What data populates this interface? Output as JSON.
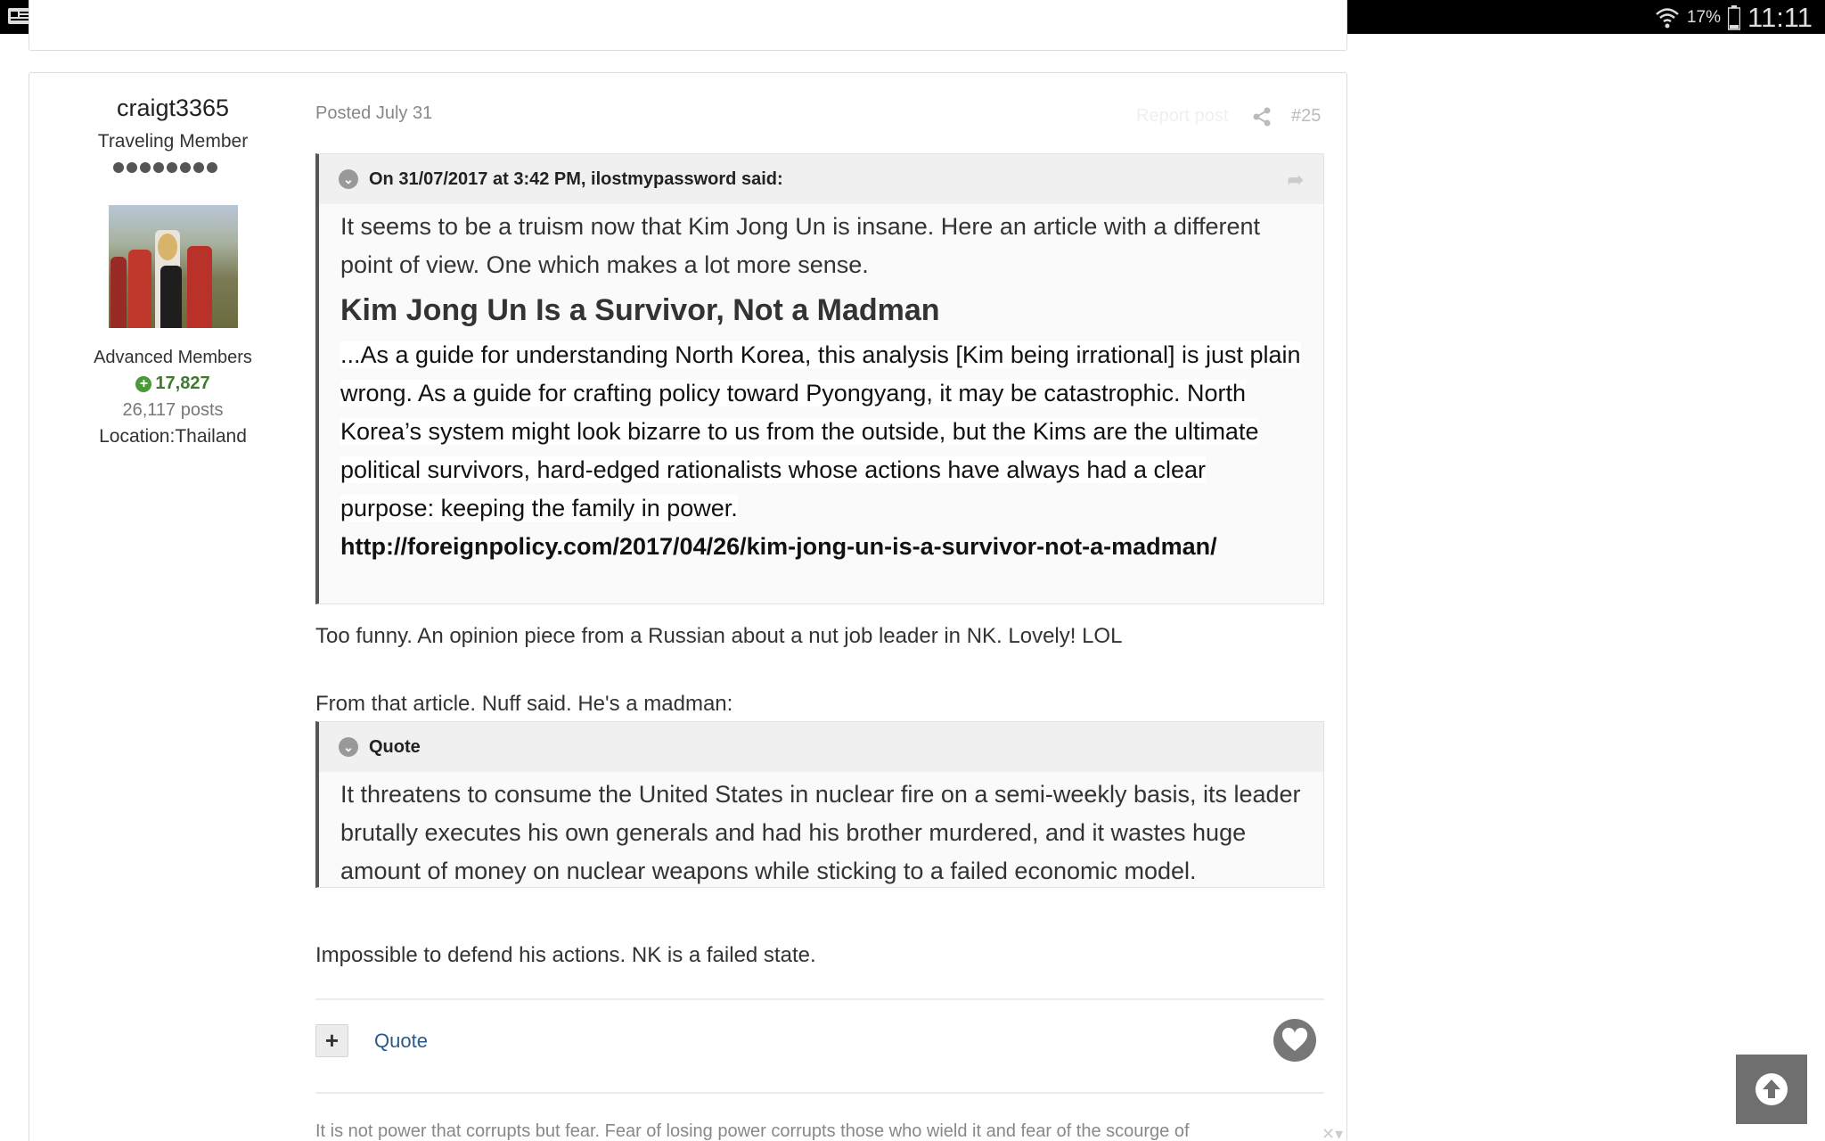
{
  "statusbar": {
    "battery_pct": "17%",
    "time": "11:11"
  },
  "author": {
    "name": "craigt3365",
    "title": "Traveling Member",
    "pips": 8,
    "group": "Advanced Members",
    "reputation": "17,827",
    "posts": "26,117 posts",
    "location": "Location:Thailand"
  },
  "post": {
    "posted": "Posted July 31",
    "report_label": "Report post",
    "number": "#25",
    "quote1": {
      "header": "On 31/07/2017 at 3:42 PM, ilostmypassword said:",
      "intro": "It seems to be a truism now that Kim Jong Un is insane. Here an article with a different point of view. One which makes a lot more sense.",
      "heading": "Kim Jong Un Is a Survivor, Not a Madman",
      "excerpt": "...As a guide for understanding North Korea, this analysis [Kim being irrational] is just plain wrong. As a guide for crafting policy toward Pyongyang, it may be catastrophic. North Korea’s system might look bizarre to us from the outside, but the Kims are the ultimate political survivors, hard-edged rationalists whose actions have always had a clear purpose: keeping the family in power.",
      "link": "http://foreignpolicy.com/2017/04/26/kim-jong-un-is-a-survivor-not-a-madman/"
    },
    "para1": "Too funny.  An opinion piece from a Russian about a nut job leader in NK.  Lovely! LOL",
    "para2": "From that article.  Nuff said.  He's a madman:",
    "quote2": {
      "header": "Quote",
      "text": "It threatens to consume the United States in nuclear fire on a semi-weekly basis, its leader brutally executes his own generals and had his brother murdered, and it wastes huge amount of money on nuclear weapons while sticking to a failed economic model."
    },
    "para3": "Impossible to defend his actions.  NK is a failed state.",
    "plus_label": "+",
    "quote_label": "Quote",
    "signature": "It is not power that corrupts but fear. Fear of losing power corrupts those who wield it and fear of the scourge of"
  },
  "colors": {
    "rep_green": "#3d7a2e",
    "link_blue": "#2a5a8a",
    "quote_border": "#555555"
  }
}
